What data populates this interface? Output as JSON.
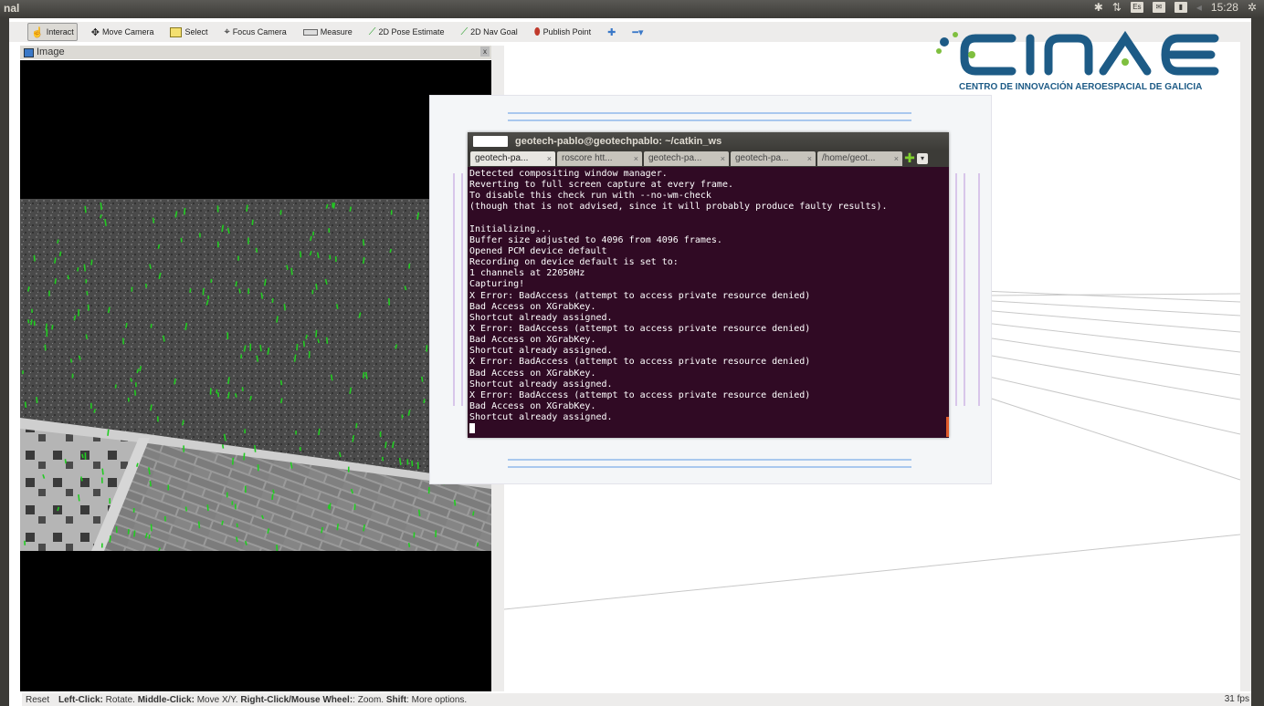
{
  "panel": {
    "window_title": "nal",
    "clock": "15:28",
    "tray_icons": [
      "bluetooth-icon",
      "network-icon",
      "keyboard-layout-icon",
      "mail-icon",
      "battery-icon",
      "volume-icon",
      "settings-gear-icon"
    ],
    "keyboard_layout": "Es"
  },
  "toolbar": {
    "tools": [
      {
        "label": "Interact",
        "icon": "hand-cursor-icon",
        "active": true
      },
      {
        "label": "Move Camera",
        "icon": "move-arrows-icon"
      },
      {
        "label": "Select",
        "icon": "select-rectangle-icon"
      },
      {
        "label": "Focus Camera",
        "icon": "crosshair-icon"
      },
      {
        "label": "Measure",
        "icon": "ruler-icon"
      },
      {
        "label": "2D Pose Estimate",
        "icon": "green-arrow-icon"
      },
      {
        "label": "2D Nav Goal",
        "icon": "green-arrow-icon"
      },
      {
        "label": "Publish Point",
        "icon": "map-pin-icon"
      }
    ]
  },
  "image_panel": {
    "title": "Image"
  },
  "logo": {
    "text": "CINAE",
    "subtitle": "CENTRO DE INNOVACIÓN AEROESPACIAL DE GALICIA",
    "brand_color": "#1d5b86",
    "accent_color": "#7fbf3f"
  },
  "terminal": {
    "title": "geotech-pablo@geotechpablo: ~/catkin_ws",
    "tabs": [
      {
        "label": "geotech-pa...",
        "active": true
      },
      {
        "label": "roscore htt..."
      },
      {
        "label": "geotech-pa..."
      },
      {
        "label": "geotech-pa..."
      },
      {
        "label": "/home/geot..."
      }
    ],
    "lines": [
      "Detected compositing window manager.",
      "Reverting to full screen capture at every frame.",
      "To disable this check run with --no-wm-check",
      "(though that is not advised, since it will probably produce faulty results).",
      "",
      "Initializing...",
      "Buffer size adjusted to 4096 from 4096 frames.",
      "Opened PCM device default",
      "Recording on device default is set to:",
      "1 channels at 22050Hz",
      "Capturing!",
      "X Error: BadAccess (attempt to access private resource denied)",
      "Bad Access on XGrabKey.",
      "Shortcut already assigned.",
      "X Error: BadAccess (attempt to access private resource denied)",
      "Bad Access on XGrabKey.",
      "Shortcut already assigned.",
      "X Error: BadAccess (attempt to access private resource denied)",
      "Bad Access on XGrabKey.",
      "Shortcut already assigned.",
      "X Error: BadAccess (attempt to access private resource denied)",
      "Bad Access on XGrabKey.",
      "Shortcut already assigned."
    ],
    "background": "#300a24"
  },
  "statusbar": {
    "reset": "Reset",
    "hints": [
      {
        "key": "Left-Click:",
        "text": " Rotate. "
      },
      {
        "key": "Middle-Click:",
        "text": " Move X/Y. "
      },
      {
        "key": "Right-Click/Mouse Wheel:",
        "text": ": Zoom. "
      },
      {
        "key": "Shift",
        "text": ": More options."
      }
    ],
    "fps": "31 fps"
  }
}
